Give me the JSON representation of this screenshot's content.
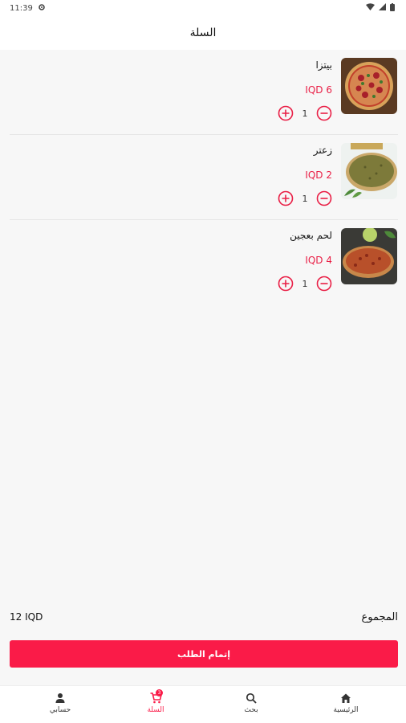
{
  "status_bar": {
    "time": "11:39"
  },
  "header": {
    "title": "السلة"
  },
  "cart_items": [
    {
      "name": "بيتزا",
      "price": "IQD 6",
      "quantity": "1",
      "image": "pizza"
    },
    {
      "name": "زعتر",
      "price": "IQD 2",
      "quantity": "1",
      "image": "zaatar"
    },
    {
      "name": "لحم بعجين",
      "price": "IQD 4",
      "quantity": "1",
      "image": "lahm-bi-ajeen"
    }
  ],
  "total": {
    "label": "المجموع",
    "amount": "12 IQD"
  },
  "checkout": {
    "label": "إتمام الطلب"
  },
  "bottom_nav": {
    "items": [
      {
        "label": "الرئيسية",
        "icon": "home-icon"
      },
      {
        "label": "بحث",
        "icon": "search-icon"
      },
      {
        "label": "السلة",
        "icon": "cart-icon",
        "active": true,
        "badge": "3"
      },
      {
        "label": "حسابي",
        "icon": "person-icon"
      }
    ]
  },
  "colors": {
    "accent": "#fa1b48",
    "price": "#e91e45"
  }
}
